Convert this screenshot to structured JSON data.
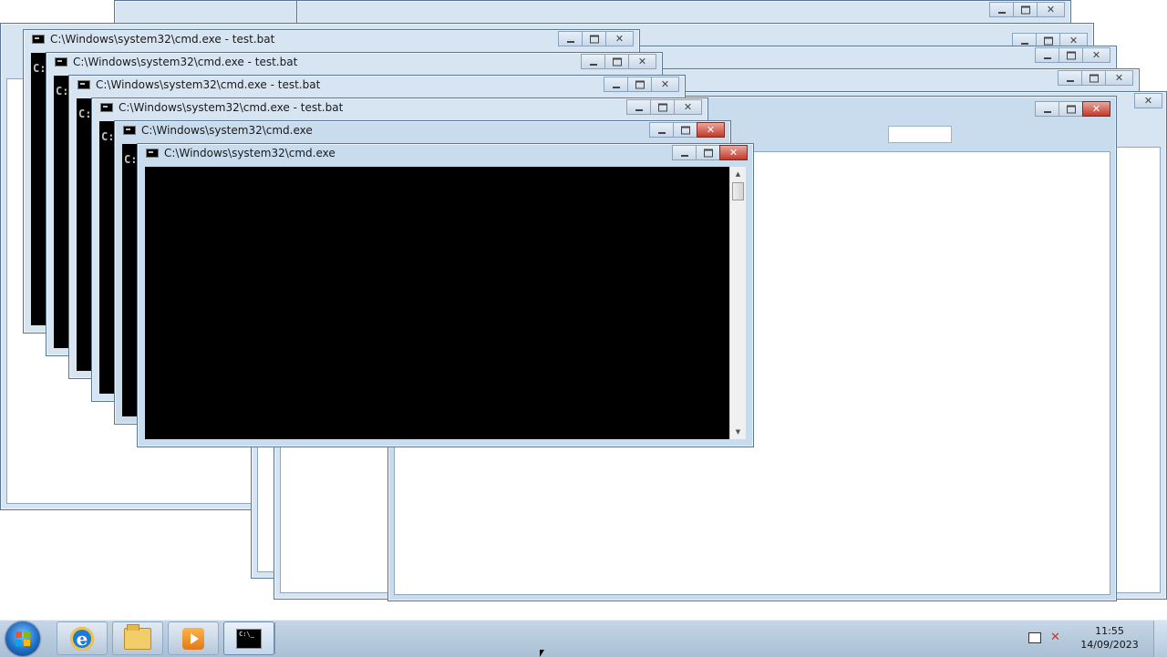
{
  "windows": {
    "cmd1_title": "C:\\Windows\\system32\\cmd.exe - test.bat",
    "cmd2_title": "C:\\Windows\\system32\\cmd.exe - test.bat",
    "cmd3_title": "C:\\Windows\\system32\\cmd.exe - test.bat",
    "cmd4_title": "C:\\Windows\\system32\\cmd.exe - test.bat",
    "cmd5_title": "C:\\Windows\\system32\\cmd.exe",
    "cmd6_title": "C:\\Windows\\system32\\cmd.exe",
    "console_prompt_char": "C:"
  },
  "caption_glyphs": {
    "minimize": "",
    "maximize": "",
    "close": "✕"
  },
  "taskbar": {
    "pinned": [
      "internet-explorer",
      "windows-explorer",
      "windows-media-player"
    ],
    "active_app": "cmd"
  },
  "tray": {
    "time": "11:55",
    "date": "14/09/2023"
  },
  "colors": {
    "frame": "#c8dcee",
    "close_active": "#c2392a",
    "console_bg": "#000000",
    "taskbar": "#b8cbe0"
  }
}
